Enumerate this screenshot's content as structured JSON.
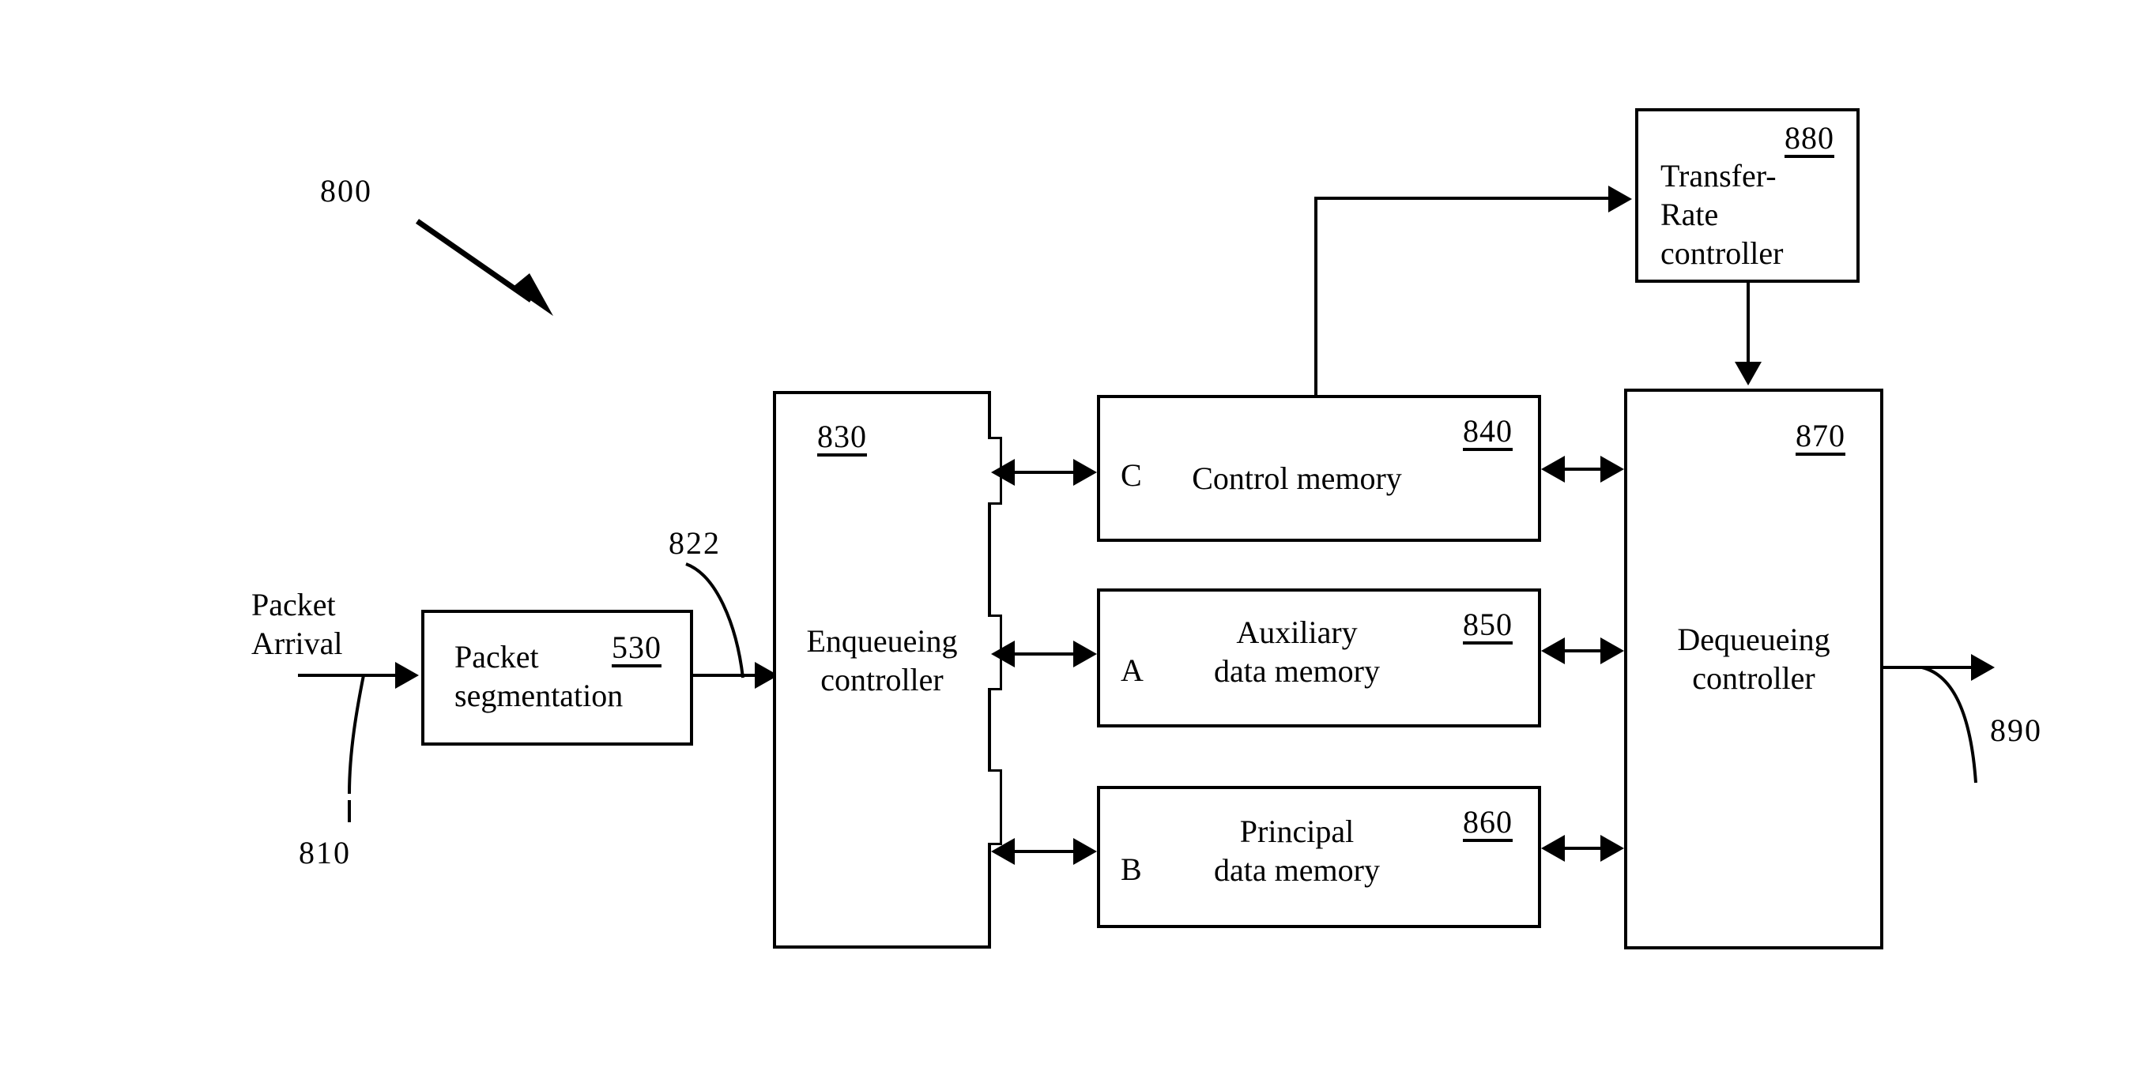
{
  "figure": {
    "number": "800",
    "type": "patent-block-diagram"
  },
  "labels": {
    "figure_ref": "800",
    "packet_arrival": "Packet\nArrival",
    "packet_arrival_ref": "810",
    "segment_link_ref": "822",
    "output_ref": "890"
  },
  "blocks": {
    "packet_segmentation": {
      "title": "Packet\nsegmentation",
      "ref": "530"
    },
    "enqueueing_controller": {
      "title": "Enqueueing\ncontroller",
      "ref": "830"
    },
    "control_memory": {
      "title": "Control memory",
      "ref": "840",
      "port": "C"
    },
    "auxiliary_data_memory": {
      "title": "Auxiliary\ndata memory",
      "ref": "850",
      "port": "A"
    },
    "principal_data_memory": {
      "title": "Principal\ndata memory",
      "ref": "860",
      "port": "B"
    },
    "dequeueing_controller": {
      "title": "Dequeueing\ncontroller",
      "ref": "870"
    },
    "transfer_rate_controller": {
      "title": "Transfer-\nRate\ncontroller",
      "ref": "880"
    }
  },
  "colors": {
    "line": "#000000",
    "background": "#ffffff"
  }
}
